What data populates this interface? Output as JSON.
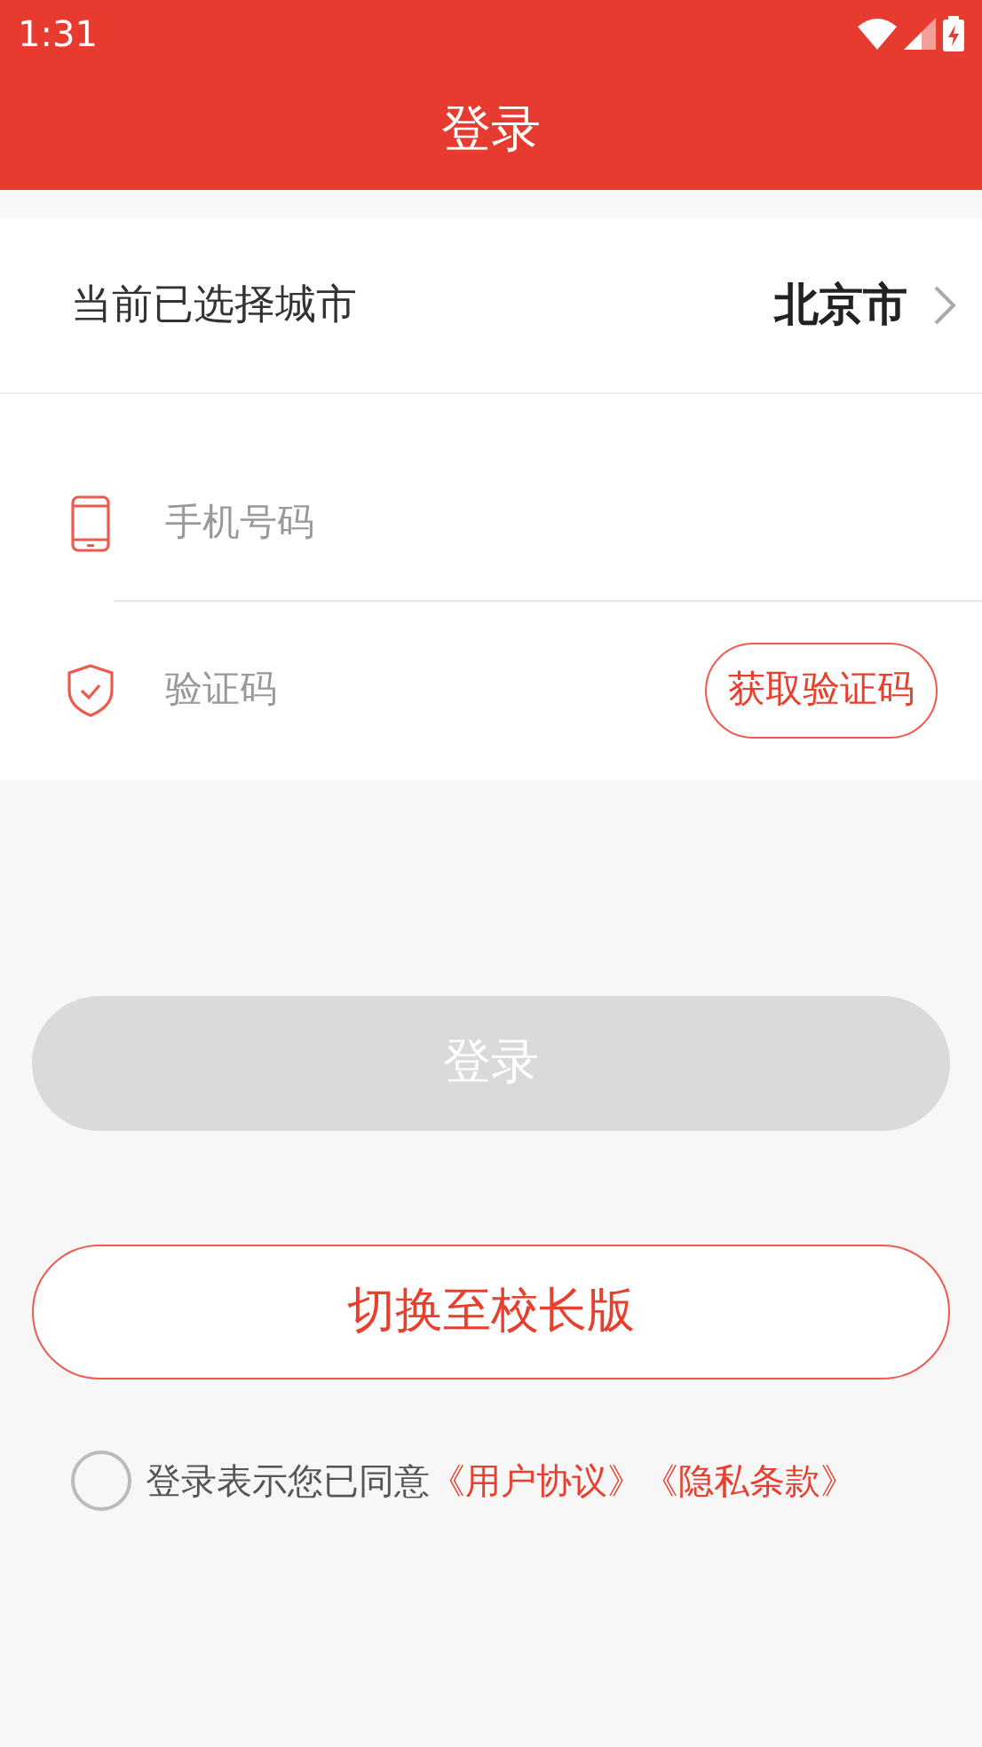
{
  "status_bar": {
    "time": "1:31"
  },
  "header": {
    "title": "登录"
  },
  "city": {
    "label": "当前已选择城市",
    "value": "北京市"
  },
  "phone_field": {
    "placeholder": "手机号码"
  },
  "code_field": {
    "placeholder": "验证码",
    "button": "获取验证码"
  },
  "login_button": {
    "label": "登录",
    "disabled": true
  },
  "switch_button": {
    "label": "切换至校长版"
  },
  "agreement": {
    "checked": false,
    "text": "登录表示您已同意",
    "links": [
      "《用户协议》",
      "《隐私条款》"
    ]
  }
}
